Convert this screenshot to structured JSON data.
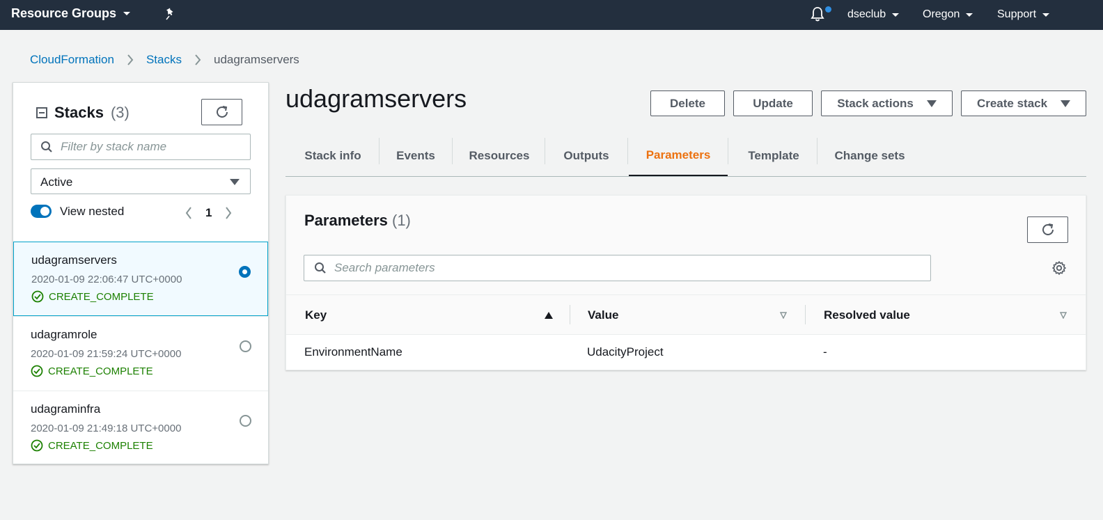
{
  "topnav": {
    "resource_groups": "Resource Groups",
    "account": "dseclub",
    "region": "Oregon",
    "support": "Support"
  },
  "breadcrumb": {
    "items": [
      "CloudFormation",
      "Stacks",
      "udagramservers"
    ]
  },
  "sidebar": {
    "title": "Stacks",
    "count": "(3)",
    "filter_placeholder": "Filter by stack name",
    "status_filter": "Active",
    "view_nested_label": "View nested",
    "view_nested_on": true,
    "page": "1",
    "stacks": [
      {
        "name": "udagramservers",
        "date": "2020-01-09 22:06:47 UTC+0000",
        "status": "CREATE_COMPLETE",
        "selected": true
      },
      {
        "name": "udagramrole",
        "date": "2020-01-09 21:59:24 UTC+0000",
        "status": "CREATE_COMPLETE",
        "selected": false
      },
      {
        "name": "udagraminfra",
        "date": "2020-01-09 21:49:18 UTC+0000",
        "status": "CREATE_COMPLETE",
        "selected": false
      }
    ]
  },
  "main": {
    "title": "udagramservers",
    "buttons": {
      "delete": "Delete",
      "update": "Update",
      "stack_actions": "Stack actions",
      "create_stack": "Create stack"
    },
    "tabs": [
      "Stack info",
      "Events",
      "Resources",
      "Outputs",
      "Parameters",
      "Template",
      "Change sets"
    ],
    "active_tab": "Parameters"
  },
  "parameters": {
    "title": "Parameters",
    "count": "(1)",
    "search_placeholder": "Search parameters",
    "columns": [
      "Key",
      "Value",
      "Resolved value"
    ],
    "rows": [
      {
        "key": "EnvironmentName",
        "value": "UdacityProject",
        "resolved": "-"
      }
    ]
  },
  "colors": {
    "nav_bg": "#232f3e",
    "link": "#0073bb",
    "active_tab": "#ec7211",
    "success": "#1d8102"
  }
}
